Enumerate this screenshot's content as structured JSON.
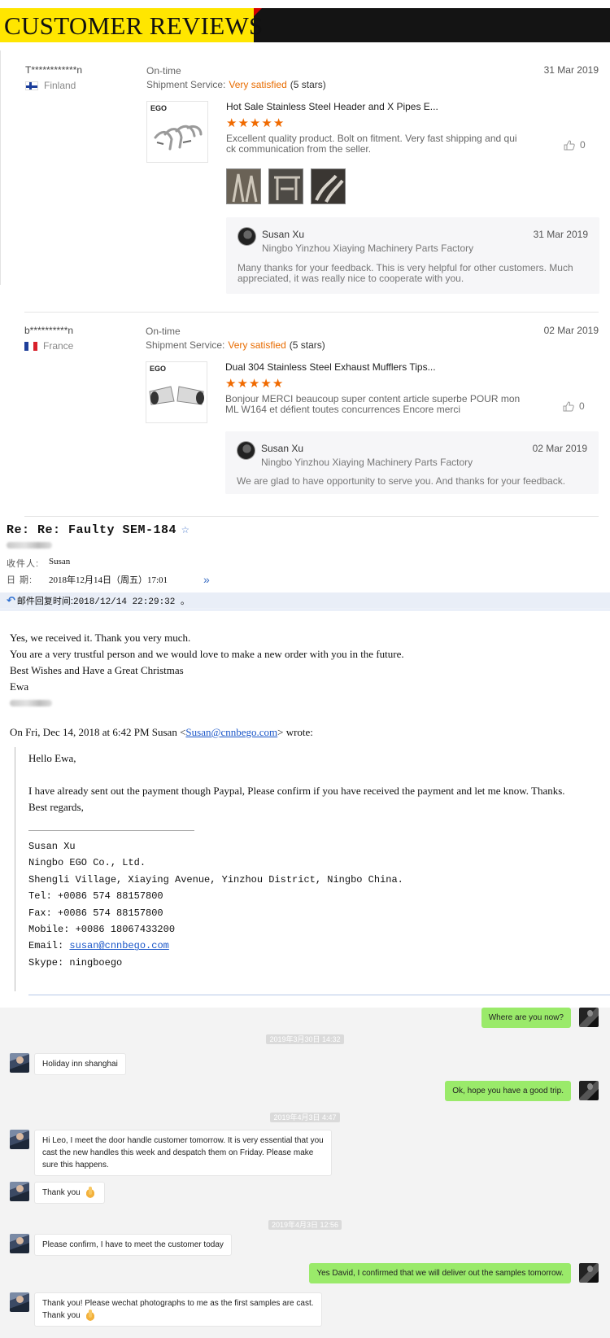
{
  "banner": {
    "title": "CUSTOMER REVIEWS"
  },
  "reviews": [
    {
      "user": "T************n",
      "country": "Finland",
      "ontime": "On-time",
      "shipping_label": "Shipment Service:",
      "satisfaction": "Very satisfied",
      "stars_text": "(5 stars)",
      "stars": 5,
      "date": "31 Mar 2019",
      "product": "Hot Sale Stainless Steel Header and X Pipes E...",
      "brand": "EGO",
      "text": "Excellent quality product. Bolt on fitment. Very fast shipping and qui ck communication from the seller.",
      "likes": "0",
      "reply": {
        "name": "Susan Xu",
        "company": "Ningbo Yinzhou Xiaying Machinery Parts Factory",
        "date": "31 Mar 2019",
        "text": "Many thanks for your feedback. This is very helpful for other customers.  Much appreciated,  it was really nice to cooperate with you."
      }
    },
    {
      "user": "b**********n",
      "country": "France",
      "ontime": "On-time",
      "shipping_label": "Shipment Service:",
      "satisfaction": "Very satisfied",
      "stars_text": "(5 stars)",
      "stars": 5,
      "date": "02 Mar 2019",
      "product": "Dual 304 Stainless Steel Exhaust Mufflers Tips...",
      "brand": "EGO",
      "text": "Bonjour MERCI beaucoup super content article superbe POUR mon ML W164 et défient toutes concurrences Encore merci",
      "likes": "0",
      "reply": {
        "name": "Susan Xu",
        "company": "Ningbo Yinzhou Xiaying Machinery Parts Factory",
        "date": "02 Mar 2019",
        "text": "We are glad to have opportunity to serve you. And thanks for your feedback."
      }
    }
  ],
  "email": {
    "subject": "Re: Re: Faulty SEM-184",
    "to_label": "收件人:",
    "to_value": "Susan",
    "date_label": "日  期:",
    "date_value": "2018年12月14日（周五）17:01",
    "reply_label": "邮件回复时间:",
    "reply_value": "2018/12/14 22:29:32 。",
    "body": [
      "Yes, we received it. Thank you very much.",
      "You are a very trustful person and we would love to make a new order with you in the future.",
      "Best Wishes and Have a Great Christmas",
      "Ewa"
    ],
    "quote_head_before": "On Fri, Dec 14, 2018 at 6:42 PM Susan <",
    "quote_head_email": "Susan@cnnbego.com",
    "quote_head_after": "> wrote:",
    "quote_hello": "Hello Ewa,",
    "quote_body": [
      "I have already sent out the payment though Paypal, Please confirm if you have received the payment and let me know. Thanks.",
      "Best regards,"
    ],
    "signature": {
      "name": "Susan Xu",
      "company": "Ningbo EGO Co., Ltd.",
      "address": "Shengli Village, Xiaying Avenue, Yinzhou District, Ningbo China.",
      "tel": "Tel: +0086 574 88157800",
      "fax": "Fax: +0086 574 88157800",
      "mobile": "Mobile:  +0086 18067433200",
      "email_label": "Email: ",
      "email": "susan@cnnbego.com",
      "skype": "Skype: ningboego"
    }
  },
  "chat": {
    "messages": [
      {
        "side": "out",
        "text": "Where are you now?"
      },
      {
        "timestamp": "2019年3月30日 14:32"
      },
      {
        "side": "in",
        "text": "Holiday inn shanghai"
      },
      {
        "side": "out",
        "text": "Ok,  hope you have a good trip."
      },
      {
        "timestamp": "2019年4月3日 4:47"
      },
      {
        "side": "in",
        "lines": [
          "Hi Leo, I meet the door handle customer tomorrow. It is very essential that you",
          "cast the new handles this week and despatch them on Friday. Please make",
          "sure this happens."
        ]
      },
      {
        "side": "in",
        "text": "Thank you",
        "emoji": "folded-hands"
      },
      {
        "timestamp": "2019年4月3日 12:56"
      },
      {
        "side": "in",
        "text": "Please confirm, I have to meet the customer today"
      },
      {
        "side": "out",
        "text": "Yes David, I confirmed that we will deliver out the samples tomorrow."
      },
      {
        "side": "in",
        "lines": [
          "Thank you! Please wechat  photographs to me as the first samples are cast.",
          "Thank you"
        ],
        "emoji": "folded-hands"
      }
    ]
  },
  "colors": {
    "banner_yellow": "#ffe600",
    "banner_black": "#141414",
    "accent_orange": "#e86c00",
    "chat_green": "#9aea6a",
    "link_blue": "#1a56c8"
  }
}
